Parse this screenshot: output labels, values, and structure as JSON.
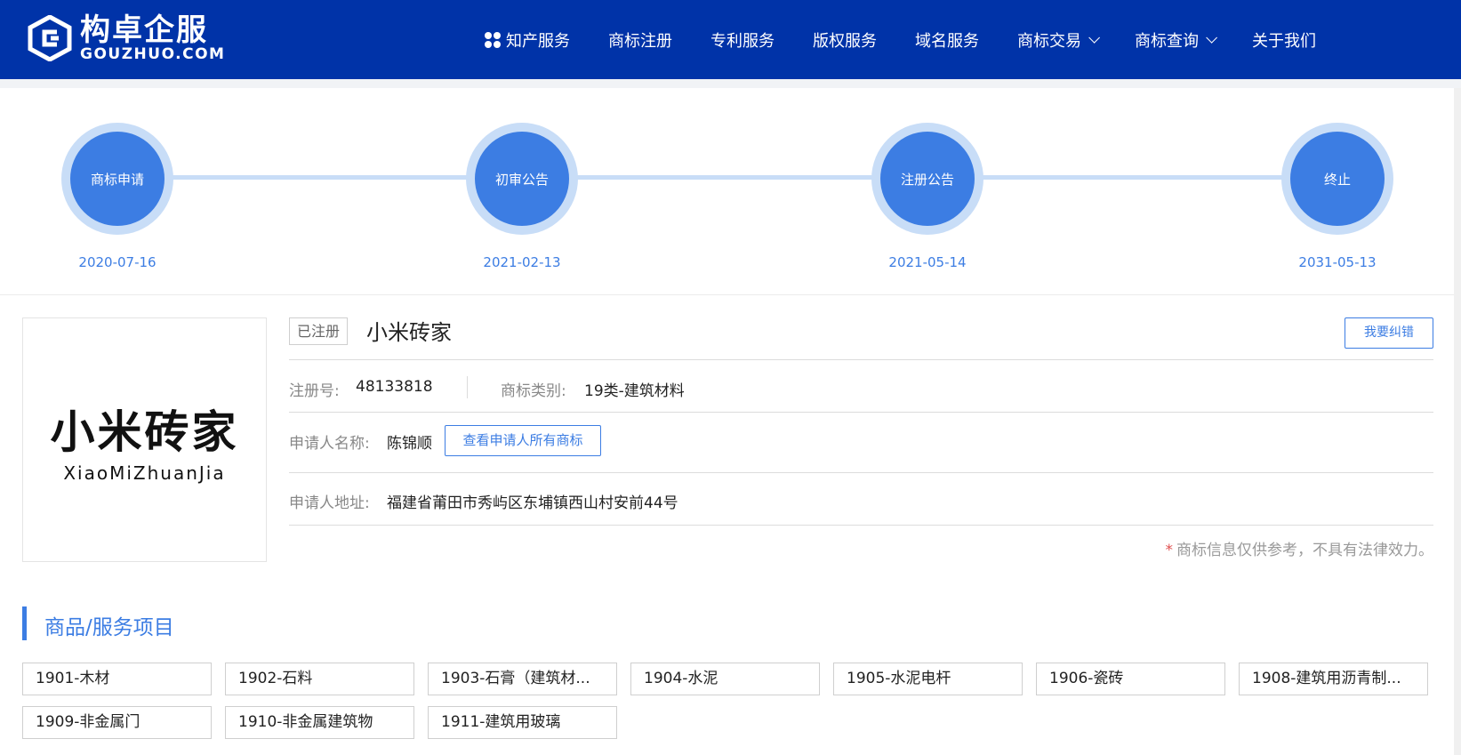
{
  "header": {
    "logo_cn": "构卓企服",
    "logo_en": "GOUZHUO.COM",
    "nav": [
      {
        "label": "知产服务"
      },
      {
        "label": "商标注册"
      },
      {
        "label": "专利服务"
      },
      {
        "label": "版权服务"
      },
      {
        "label": "域名服务"
      },
      {
        "label": "商标交易"
      },
      {
        "label": "商标查询"
      },
      {
        "label": "关于我们"
      }
    ]
  },
  "timeline": [
    {
      "label": "商标申请",
      "date": "2020-07-16"
    },
    {
      "label": "初审公告",
      "date": "2021-02-13"
    },
    {
      "label": "注册公告",
      "date": "2021-05-14"
    },
    {
      "label": "终止",
      "date": "2031-05-13"
    }
  ],
  "trademark": {
    "image_cn": "小米砖家",
    "image_en": "XiaoMiZhuanJia",
    "status": "已注册",
    "name": "小米砖家",
    "report_label": "我要纠错",
    "reg_no_label": "注册号:",
    "reg_no": "48133818",
    "class_label": "商标类别:",
    "class_value": "19类-建筑材料",
    "applicant_label": "申请人名称:",
    "applicant": "陈锦顺",
    "view_all_label": "查看申请人所有商标",
    "address_label": "申请人地址:",
    "address": "福建省莆田市秀屿区东埔镇西山村安前44号",
    "disclaimer_star": "*",
    "disclaimer": "商标信息仅供参考，不具有法律效力。"
  },
  "goods": {
    "title": "商品/服务项目",
    "items": [
      "1901-木材",
      "1902-石料",
      "1903-石膏（建筑材...",
      "1904-水泥",
      "1905-水泥电杆",
      "1906-瓷砖",
      "1908-建筑用沥青制...",
      "1909-非金属门",
      "1910-非金属建筑物",
      "1911-建筑用玻璃"
    ]
  },
  "colors": {
    "header_bg": "#0033a8",
    "accent": "#3c7de3",
    "ring": "#c8ddf7"
  }
}
